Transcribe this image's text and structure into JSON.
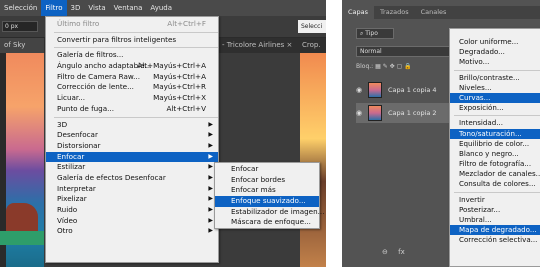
{
  "menubar": {
    "items": [
      "Selección",
      "Filtro",
      "3D",
      "Vista",
      "Ventana",
      "Ayuda"
    ],
    "active": "Filtro"
  },
  "optbar": {
    "field": "0 px",
    "select": "Selecci"
  },
  "tabs": {
    "doc_tab": "of Sky [RU]",
    "other": "- Tricolore Airlines ×",
    "crop": "Crop."
  },
  "filtro_menu": [
    {
      "label": "Último filtro",
      "shortcut": "Alt+Ctrl+F",
      "disabled": true
    },
    {
      "sep": true
    },
    {
      "label": "Convertir para filtros inteligentes"
    },
    {
      "sep": true
    },
    {
      "label": "Galería de filtros..."
    },
    {
      "label": "Ángulo ancho adaptable...",
      "shortcut": "Alt+Mayús+Ctrl+A"
    },
    {
      "label": "Filtro de Camera Raw...",
      "shortcut": "Mayús+Ctrl+A"
    },
    {
      "label": "Corrección de lente...",
      "shortcut": "Mayús+Ctrl+R"
    },
    {
      "label": "Licuar...",
      "shortcut": "Mayús+Ctrl+X"
    },
    {
      "label": "Punto de fuga...",
      "shortcut": "Alt+Ctrl+V"
    },
    {
      "sep": true
    },
    {
      "label": "3D",
      "submenu": true
    },
    {
      "label": "Desenfocar",
      "submenu": true
    },
    {
      "label": "Distorsionar",
      "submenu": true
    },
    {
      "label": "Enfocar",
      "submenu": true,
      "highlight": true
    },
    {
      "label": "Estilizar",
      "submenu": true
    },
    {
      "label": "Galería de efectos Desenfocar",
      "submenu": true
    },
    {
      "label": "Interpretar",
      "submenu": true
    },
    {
      "label": "Pixelizar",
      "submenu": true
    },
    {
      "label": "Ruido",
      "submenu": true
    },
    {
      "label": "Vídeo",
      "submenu": true
    },
    {
      "label": "Otro",
      "submenu": true
    }
  ],
  "enfocar_menu": [
    {
      "label": "Enfocar"
    },
    {
      "label": "Enfocar bordes"
    },
    {
      "label": "Enfocar más"
    },
    {
      "label": "Enfoque suavizado...",
      "highlight": true
    },
    {
      "label": "Estabilizador de imagen..."
    },
    {
      "label": "Máscara de enfoque..."
    }
  ],
  "layers_panel": {
    "tabs": [
      "Capas",
      "Trazados",
      "Canales"
    ],
    "active_tab": "Capas",
    "filter": "Tipo",
    "blend_mode": "Normal",
    "lock_label": "Bloq.:",
    "layers": [
      {
        "name": "Capa 1 copia 4",
        "selected": false
      },
      {
        "name": "Capa 1 copia 2",
        "selected": true
      }
    ],
    "bottom_icons": [
      "⊖",
      "fx"
    ]
  },
  "adjust_menu": [
    {
      "label": "Color uniforme..."
    },
    {
      "label": "Degradado..."
    },
    {
      "label": "Motivo..."
    },
    {
      "sep": true
    },
    {
      "label": "Brillo/contraste..."
    },
    {
      "label": "Niveles..."
    },
    {
      "label": "Curvas...",
      "highlight": true
    },
    {
      "label": "Exposición..."
    },
    {
      "sep": true
    },
    {
      "label": "Intensidad..."
    },
    {
      "label": "Tono/saturación...",
      "highlight": true
    },
    {
      "label": "Equilibrio de color..."
    },
    {
      "label": "Blanco y negro..."
    },
    {
      "label": "Filtro de fotografía..."
    },
    {
      "label": "Mezclador de canales..."
    },
    {
      "label": "Consulta de colores..."
    },
    {
      "sep": true
    },
    {
      "label": "Invertir"
    },
    {
      "label": "Posterizar..."
    },
    {
      "label": "Umbral..."
    },
    {
      "label": "Mapa de degradado...",
      "highlight": true
    },
    {
      "label": "Corrección selectiva..."
    }
  ],
  "colors": {
    "highlight": "#0d62c3",
    "menu_bg": "#f0f0f0",
    "panel_bg": "#535353"
  }
}
